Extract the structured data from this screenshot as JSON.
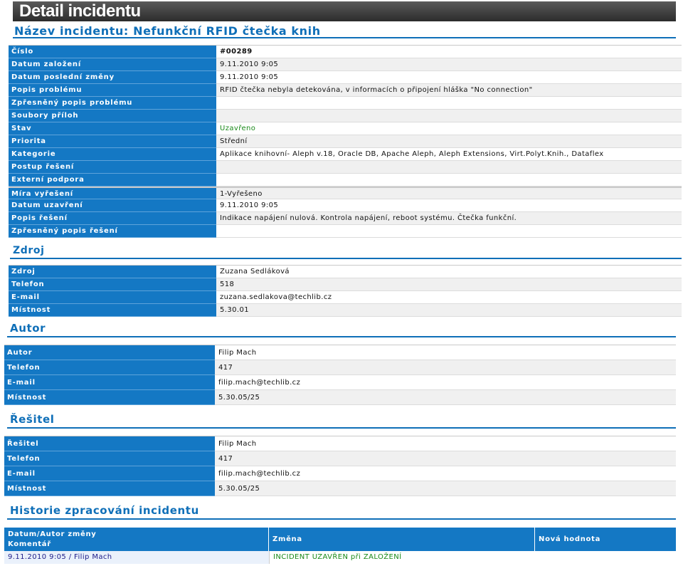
{
  "header": {
    "title": "Detail incidentu"
  },
  "incident": {
    "heading": "Název incidentu: Nefunkční RFID čtečka knih",
    "rows": [
      {
        "label": "Číslo",
        "value": "#00289"
      },
      {
        "label": "Datum založení",
        "value": "9.11.2010 9:05"
      },
      {
        "label": "Datum poslední změny",
        "value": "9.11.2010 9:05"
      },
      {
        "label": "Popis problému",
        "value": "RFID čtečka nebyla detekována, v informacích o připojení hláška \"No connection\""
      },
      {
        "label": "Zpřesněný popis problému",
        "value": ""
      },
      {
        "label": "Soubory příloh",
        "value": ""
      },
      {
        "label": "Stav",
        "value": "Uzavřeno"
      },
      {
        "label": "Priorita",
        "value": "Střední"
      },
      {
        "label": "Kategorie",
        "value": "Aplikace knihovní- Aleph v.18, Oracle DB, Apache Aleph, Aleph Extensions, Virt.Polyt.Knih., Dataflex"
      },
      {
        "label": "Postup řešení",
        "value": ""
      },
      {
        "label": "Externí podpora",
        "value": ""
      },
      {
        "label": "Míra vyřešení",
        "value": "1-Vyřešeno"
      },
      {
        "label": "Datum uzavření",
        "value": "9.11.2010 9:05"
      },
      {
        "label": "Popis řešení",
        "value": "Indikace napájení nulová. Kontrola napájení, reboot systému. Čtečka funkční."
      },
      {
        "label": "Zpřesněný popis řešení",
        "value": ""
      }
    ]
  },
  "source": {
    "heading": "Zdroj",
    "rows": [
      {
        "label": "Zdroj",
        "value": "Zuzana Sedláková"
      },
      {
        "label": "Telefon",
        "value": "518"
      },
      {
        "label": "E-mail",
        "value": "zuzana.sedlakova@techlib.cz"
      },
      {
        "label": "Místnost",
        "value": "5.30.01"
      }
    ]
  },
  "author": {
    "heading": "Autor",
    "rows": [
      {
        "label": "Autor",
        "value": "Filip Mach"
      },
      {
        "label": "Telefon",
        "value": "417"
      },
      {
        "label": "E-mail",
        "value": "filip.mach@techlib.cz"
      },
      {
        "label": "Místnost",
        "value": "5.30.05/25"
      }
    ]
  },
  "solver": {
    "heading": "Řešitel",
    "rows": [
      {
        "label": "Řešitel",
        "value": "Filip Mach"
      },
      {
        "label": "Telefon",
        "value": "417"
      },
      {
        "label": "E-mail",
        "value": "filip.mach@techlib.cz"
      },
      {
        "label": "Místnost",
        "value": "5.30.05/25"
      }
    ]
  },
  "history": {
    "heading": "Historie zpracování incidentu",
    "columns": {
      "date_author": "Datum/Autor změny",
      "comment": "Komentář",
      "change": "Změna",
      "new_value": "Nová hodnota"
    },
    "rows": [
      {
        "date_author": "9.11.2010 9:05 / Filip Mach",
        "change": "INCIDENT UZAVŘEN při ZALOŽENÍ",
        "new_value": ""
      }
    ]
  },
  "colors": {
    "label_bg": "#1478c4",
    "heading": "#0f6fb8",
    "status_green": "#1a8a1a",
    "title_bar": "#3a3a3a"
  }
}
